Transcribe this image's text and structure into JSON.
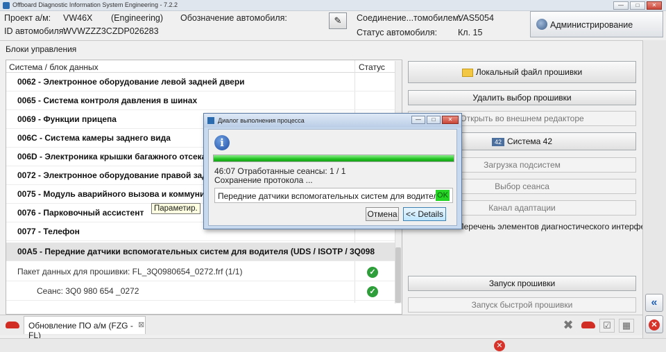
{
  "window": {
    "title": "Offboard Diagnostic Information System Engineering - 7.2.2"
  },
  "header": {
    "project_label": "Проект а/м:",
    "project_value": "VW46X",
    "project_mode": "(Engineering)",
    "vehicle_designation_label": "Обозначение автомобиля:",
    "vehicle_id_label": "ID автомобиля:",
    "vehicle_id_value": "WVWZZZ3CZDP026283",
    "connection_label": "Соединение...томобилем:",
    "connection_value": "VAS5054",
    "vehicle_status_label": "Статус автомобиля:",
    "vehicle_status_value": "Кл. 15",
    "admin_button": "Администрирование"
  },
  "tree": {
    "panel_label": "Блоки управления",
    "col_system": "Система / блок данных",
    "col_status": "Статус",
    "rows": [
      {
        "label": "0062 - Электронное оборудование левой задней двери"
      },
      {
        "label": "0065 - Система контроля давления в шинах"
      },
      {
        "label": "0069 - Функции прицепа"
      },
      {
        "label": "006C - Система камеры заднего вида"
      },
      {
        "label": "006D - Электроника крышки багажного отсека"
      },
      {
        "label": "0072 - Электронное оборудование правой задн"
      },
      {
        "label": "0075 - Модуль аварийного вызова и коммуника"
      },
      {
        "label": "0076 - Парковочный ассистент"
      },
      {
        "label": "0077 - Телефон"
      },
      {
        "label": "00A5 - Передние датчики вспомогательных систем для водителя  (UDS / ISOTP / 3Q098"
      },
      {
        "label": "Пакет данных для прошивки: FL_3Q0980654_0272.frf (1/1)",
        "status": "ok"
      },
      {
        "label": "Сеанс: 3Q0 980 654 _0272",
        "status": "ok"
      }
    ],
    "tooltip": "Параметир."
  },
  "actions": {
    "local_file": "Локальный файл прошивки",
    "delete_selection": "Удалить выбор прошивки",
    "open_external": "Открыть во внешнем редакторе",
    "system42": "Система 42",
    "system42_badge": "42",
    "load_subsystems": "Загрузка подсистем",
    "select_session": "Выбор сеанса",
    "adaptation_channel": "Канал адаптации",
    "interface_list": "Перечень элементов диагностического интерфейса",
    "start_flash": "Запуск прошивки",
    "start_fast_flash": "Запуск быстрой прошивки"
  },
  "dialog": {
    "title": "Диалог выполнения процесса",
    "progress": 1.0,
    "time_line": "46:07  Отработанные сеансы: 1 / 1",
    "status_line": "Сохранение протокола ...",
    "message": "Передние датчики вспомогательных систем для водителя",
    "message_status": "OK",
    "cancel_button": "Отмена",
    "details_button": "<< Details"
  },
  "tabs": [
    {
      "label": "Обновление ПО а/м (FZG - FL)"
    }
  ],
  "icons": {
    "app": "app-icon",
    "info": "info-icon",
    "ok": "check-circle-icon",
    "error": "error-circle-icon"
  },
  "colors": {
    "progress_green": "#22c222",
    "ok_green": "#2e9e3a",
    "error_red": "#d8332a",
    "accent_blue": "#2160b7"
  }
}
